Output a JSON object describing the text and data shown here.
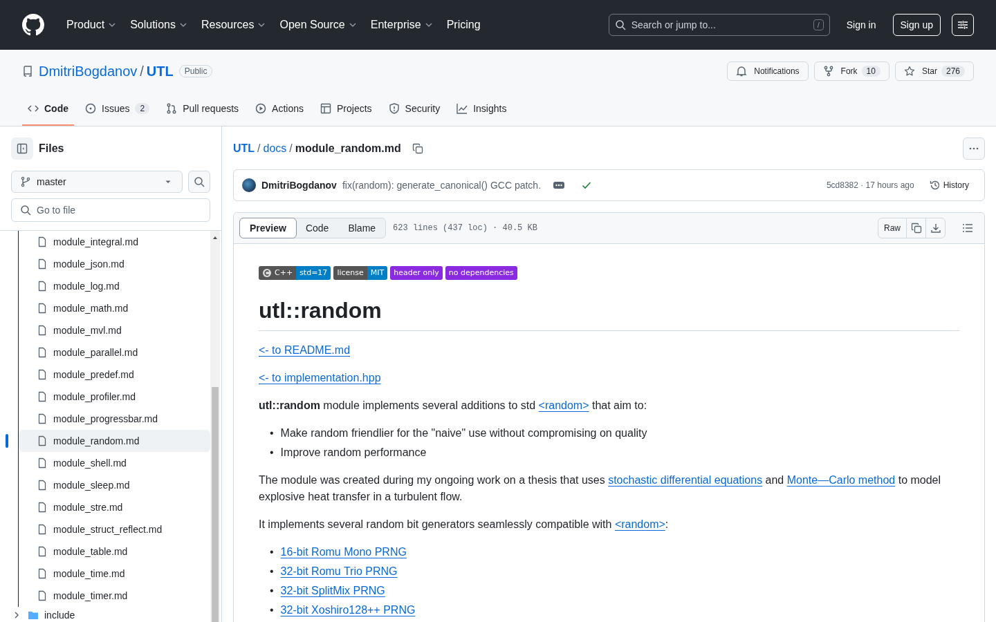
{
  "header": {
    "nav": [
      {
        "label": "Product",
        "dropdown": true
      },
      {
        "label": "Solutions",
        "dropdown": true
      },
      {
        "label": "Resources",
        "dropdown": true
      },
      {
        "label": "Open Source",
        "dropdown": true
      },
      {
        "label": "Enterprise",
        "dropdown": true
      },
      {
        "label": "Pricing",
        "dropdown": false
      }
    ],
    "search_placeholder": "Search or jump to...",
    "search_key": "/",
    "sign_in": "Sign in",
    "sign_up": "Sign up"
  },
  "repo": {
    "owner": "DmitriBogdanov",
    "separator": "/",
    "name": "UTL",
    "visibility": "Public",
    "notifications": "Notifications",
    "fork": "Fork",
    "fork_count": "10",
    "star": "Star",
    "star_count": "276"
  },
  "tabs": [
    {
      "label": "Code",
      "selected": true
    },
    {
      "label": "Issues",
      "count": "2",
      "selected": false
    },
    {
      "label": "Pull requests",
      "selected": false
    },
    {
      "label": "Actions",
      "selected": false
    },
    {
      "label": "Projects",
      "selected": false
    },
    {
      "label": "Security",
      "selected": false
    },
    {
      "label": "Insights",
      "selected": false
    }
  ],
  "sidebar": {
    "title": "Files",
    "branch": "master",
    "goto_placeholder": "Go to file",
    "files": [
      {
        "name": "module_integral.md",
        "selected": false
      },
      {
        "name": "module_json.md",
        "selected": false
      },
      {
        "name": "module_log.md",
        "selected": false
      },
      {
        "name": "module_math.md",
        "selected": false
      },
      {
        "name": "module_mvl.md",
        "selected": false
      },
      {
        "name": "module_parallel.md",
        "selected": false
      },
      {
        "name": "module_predef.md",
        "selected": false
      },
      {
        "name": "module_profiler.md",
        "selected": false
      },
      {
        "name": "module_progressbar.md",
        "selected": false
      },
      {
        "name": "module_random.md",
        "selected": true
      },
      {
        "name": "module_shell.md",
        "selected": false
      },
      {
        "name": "module_sleep.md",
        "selected": false
      },
      {
        "name": "module_stre.md",
        "selected": false
      },
      {
        "name": "module_struct_reflect.md",
        "selected": false
      },
      {
        "name": "module_table.md",
        "selected": false
      },
      {
        "name": "module_time.md",
        "selected": false
      },
      {
        "name": "module_timer.md",
        "selected": false
      }
    ],
    "folders": [
      {
        "name": "include",
        "expanded": false
      }
    ]
  },
  "breadcrumb": {
    "parts": [
      {
        "label": "UTL",
        "separator": "/"
      },
      {
        "label": "docs",
        "separator": "/"
      }
    ],
    "file": "module_random.md"
  },
  "commit": {
    "author": "DmitriBogdanov",
    "message": "fix(random): generate_canonical() GCC patch.",
    "meta": "5cd8382 · 17 hours ago",
    "history": "History"
  },
  "file_toolbar": {
    "views": [
      {
        "label": "Preview",
        "selected": true
      },
      {
        "label": "Code",
        "selected": false
      },
      {
        "label": "Blame",
        "selected": false
      }
    ],
    "info": "623 lines (437 loc) · 40.5 KB",
    "raw": "Raw"
  },
  "content": {
    "badges": [
      {
        "label": "C++",
        "value": "std=17",
        "logo": true,
        "color": "#007ec6"
      },
      {
        "label": "license",
        "value": "MIT",
        "logo": false,
        "color": "#007ec6"
      },
      {
        "value": "header only",
        "logo": false,
        "color": "#8a2be2"
      },
      {
        "value": "no dependencies",
        "logo": false,
        "color": "#8a2be2"
      }
    ],
    "title": "utl::random",
    "nav_links": [
      "<- to README.md",
      "<- to implementation.hpp"
    ],
    "intro": [
      {
        "kind": "bold",
        "text": "utl::random"
      },
      {
        "kind": "text",
        "text": " module implements several additions to std "
      },
      {
        "kind": "link",
        "text": "<random>"
      },
      {
        "kind": "text",
        "text": " that aim to:"
      }
    ],
    "aims": [
      {
        "bullet": "•",
        "text": "Make random friendlier for the \"naive\" use without compromising on quality"
      },
      {
        "bullet": "•",
        "text": "Improve random performance"
      }
    ],
    "thesis": [
      {
        "kind": "text",
        "text": "The module was created during my ongoing work on a thesis that uses "
      },
      {
        "kind": "link",
        "text": "stochastic differential equations"
      },
      {
        "kind": "text",
        "text": " and "
      },
      {
        "kind": "link",
        "text": "Monte—Carlo method"
      },
      {
        "kind": "text",
        "text": " to model explosive heat transfer in a turbulent flow."
      }
    ],
    "generators_intro": [
      {
        "kind": "text",
        "text": "It implements several random bit generators seamlessly compatible with "
      },
      {
        "kind": "link",
        "text": "<random>"
      },
      {
        "kind": "text",
        "text": ":"
      }
    ],
    "generators": [
      {
        "bullet": "•",
        "text": "16-bit Romu Mono PRNG"
      },
      {
        "bullet": "•",
        "text": "32-bit Romu Trio PRNG"
      },
      {
        "bullet": "•",
        "text": "32-bit SplitMix PRNG"
      },
      {
        "bullet": "•",
        "text": "32-bit Xoshiro128++ PRNG"
      }
    ]
  }
}
